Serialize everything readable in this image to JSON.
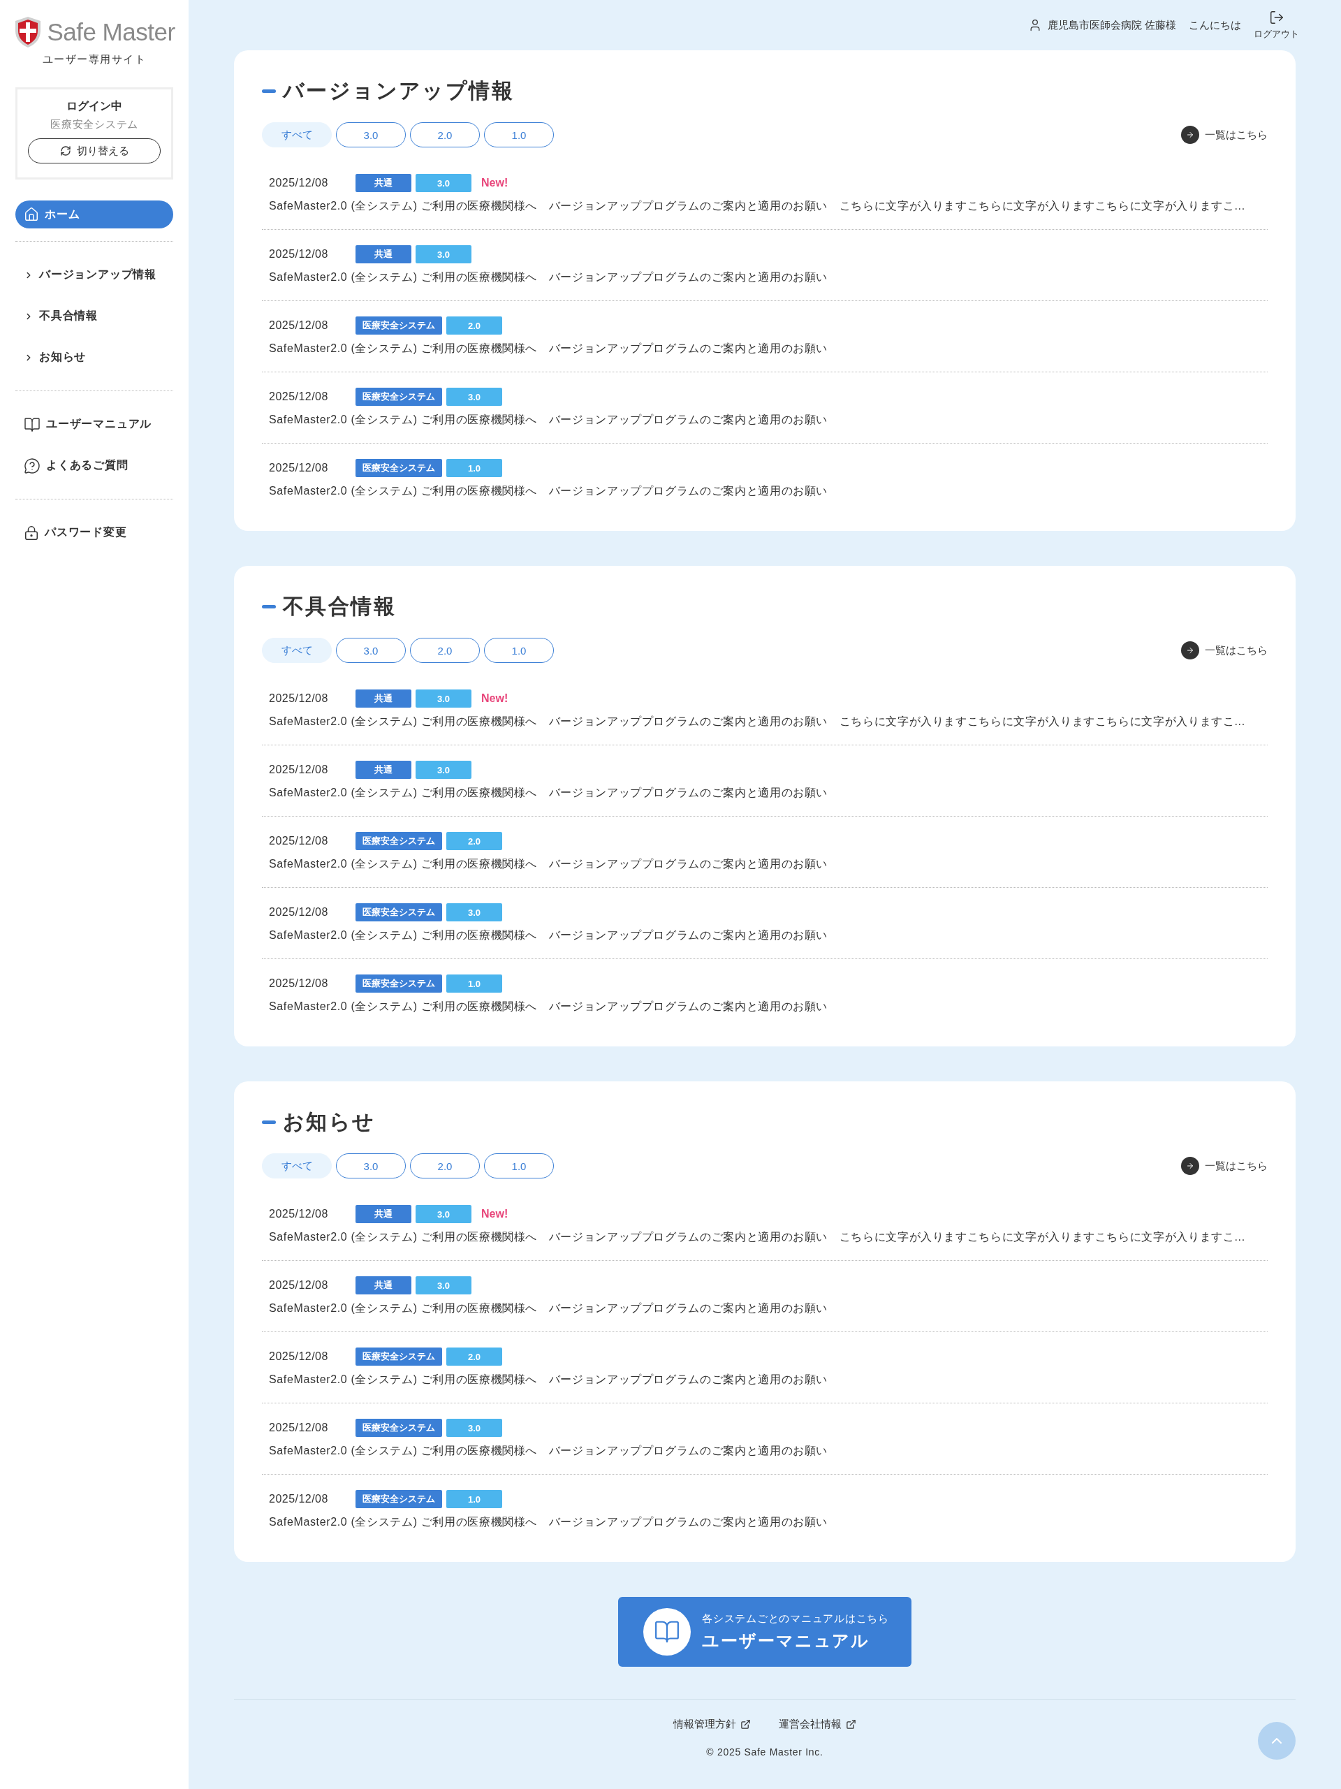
{
  "header": {
    "user": "鹿児島市医師会病院 佐藤様",
    "greeting": "こんにちは",
    "logout": "ログアウト"
  },
  "sidebar": {
    "logo": "Safe Master",
    "subtitle": "ユーザー専用サイト",
    "login": {
      "status": "ログイン中",
      "system": "医療安全システム",
      "switch_button": "切り替える"
    },
    "nav_groups": [
      [
        {
          "label": "ホーム",
          "kind": "home",
          "selected": true
        }
      ],
      [
        {
          "label": "バージョンアップ情報",
          "kind": "link",
          "selected": false
        },
        {
          "label": "不具合情報",
          "kind": "link",
          "selected": false
        },
        {
          "label": "お知らせ",
          "kind": "link",
          "selected": false
        }
      ],
      [
        {
          "label": "ユーザーマニュアル",
          "kind": "manual",
          "selected": false
        },
        {
          "label": "よくあるご質問",
          "kind": "faq",
          "selected": false
        }
      ],
      [
        {
          "label": "パスワード変更",
          "kind": "password",
          "selected": false
        }
      ]
    ]
  },
  "sections": [
    {
      "title": "バージョンアップ情報",
      "filters": [
        {
          "label": "すべて",
          "selected": true
        },
        {
          "label": "3.0",
          "selected": false
        },
        {
          "label": "2.0",
          "selected": false
        },
        {
          "label": "1.0",
          "selected": false
        }
      ],
      "more_link": "一覧はこちら",
      "items": [
        {
          "date": "2025/12/08",
          "tags": [
            {
              "label": "共通",
              "kind": "category"
            },
            {
              "label": "3.0",
              "kind": "version"
            }
          ],
          "badge": "New!",
          "text": "SafeMaster2.0 (全システム) ご利用の医療機関様へ　バージョンアッププログラムのご案内と適用のお願い　こちらに文字が入りますこちらに文字が入りますこちらに文字が入りますこ..."
        },
        {
          "date": "2025/12/08",
          "tags": [
            {
              "label": "共通",
              "kind": "category"
            },
            {
              "label": "3.0",
              "kind": "version"
            }
          ],
          "text": "SafeMaster2.0 (全システム) ご利用の医療機関様へ　バージョンアッププログラムのご案内と適用のお願い"
        },
        {
          "date": "2025/12/08",
          "tags": [
            {
              "label": "医療安全システム",
              "kind": "category"
            },
            {
              "label": "2.0",
              "kind": "version"
            }
          ],
          "text": "SafeMaster2.0 (全システム) ご利用の医療機関様へ　バージョンアッププログラムのご案内と適用のお願い"
        },
        {
          "date": "2025/12/08",
          "tags": [
            {
              "label": "医療安全システム",
              "kind": "category"
            },
            {
              "label": "3.0",
              "kind": "version"
            }
          ],
          "text": "SafeMaster2.0 (全システム) ご利用の医療機関様へ　バージョンアッププログラムのご案内と適用のお願い"
        },
        {
          "date": "2025/12/08",
          "tags": [
            {
              "label": "医療安全システム",
              "kind": "category"
            },
            {
              "label": "1.0",
              "kind": "version"
            }
          ],
          "text": "SafeMaster2.0 (全システム) ご利用の医療機関様へ　バージョンアッププログラムのご案内と適用のお願い"
        }
      ]
    },
    {
      "title": "不具合情報",
      "filters": [
        {
          "label": "すべて",
          "selected": true
        },
        {
          "label": "3.0",
          "selected": false
        },
        {
          "label": "2.0",
          "selected": false
        },
        {
          "label": "1.0",
          "selected": false
        }
      ],
      "more_link": "一覧はこちら",
      "items": [
        {
          "date": "2025/12/08",
          "tags": [
            {
              "label": "共通",
              "kind": "category"
            },
            {
              "label": "3.0",
              "kind": "version"
            }
          ],
          "badge": "New!",
          "text": "SafeMaster2.0 (全システム) ご利用の医療機関様へ　バージョンアッププログラムのご案内と適用のお願い　こちらに文字が入りますこちらに文字が入りますこちらに文字が入りますこ..."
        },
        {
          "date": "2025/12/08",
          "tags": [
            {
              "label": "共通",
              "kind": "category"
            },
            {
              "label": "3.0",
              "kind": "version"
            }
          ],
          "text": "SafeMaster2.0 (全システム) ご利用の医療機関様へ　バージョンアッププログラムのご案内と適用のお願い"
        },
        {
          "date": "2025/12/08",
          "tags": [
            {
              "label": "医療安全システム",
              "kind": "category"
            },
            {
              "label": "2.0",
              "kind": "version"
            }
          ],
          "text": "SafeMaster2.0 (全システム) ご利用の医療機関様へ　バージョンアッププログラムのご案内と適用のお願い"
        },
        {
          "date": "2025/12/08",
          "tags": [
            {
              "label": "医療安全システム",
              "kind": "category"
            },
            {
              "label": "3.0",
              "kind": "version"
            }
          ],
          "text": "SafeMaster2.0 (全システム) ご利用の医療機関様へ　バージョンアッププログラムのご案内と適用のお願い"
        },
        {
          "date": "2025/12/08",
          "tags": [
            {
              "label": "医療安全システム",
              "kind": "category"
            },
            {
              "label": "1.0",
              "kind": "version"
            }
          ],
          "text": "SafeMaster2.0 (全システム) ご利用の医療機関様へ　バージョンアッププログラムのご案内と適用のお願い"
        }
      ]
    },
    {
      "title": "お知らせ",
      "filters": [
        {
          "label": "すべて",
          "selected": true
        },
        {
          "label": "3.0",
          "selected": false
        },
        {
          "label": "2.0",
          "selected": false
        },
        {
          "label": "1.0",
          "selected": false
        }
      ],
      "more_link": "一覧はこちら",
      "items": [
        {
          "date": "2025/12/08",
          "tags": [
            {
              "label": "共通",
              "kind": "category"
            },
            {
              "label": "3.0",
              "kind": "version"
            }
          ],
          "badge": "New!",
          "text": "SafeMaster2.0 (全システム) ご利用の医療機関様へ　バージョンアッププログラムのご案内と適用のお願い　こちらに文字が入りますこちらに文字が入りますこちらに文字が入りますこ..."
        },
        {
          "date": "2025/12/08",
          "tags": [
            {
              "label": "共通",
              "kind": "category"
            },
            {
              "label": "3.0",
              "kind": "version"
            }
          ],
          "text": "SafeMaster2.0 (全システム) ご利用の医療機関様へ　バージョンアッププログラムのご案内と適用のお願い"
        },
        {
          "date": "2025/12/08",
          "tags": [
            {
              "label": "医療安全システム",
              "kind": "category"
            },
            {
              "label": "2.0",
              "kind": "version"
            }
          ],
          "text": "SafeMaster2.0 (全システム) ご利用の医療機関様へ　バージョンアッププログラムのご案内と適用のお願い"
        },
        {
          "date": "2025/12/08",
          "tags": [
            {
              "label": "医療安全システム",
              "kind": "category"
            },
            {
              "label": "3.0",
              "kind": "version"
            }
          ],
          "text": "SafeMaster2.0 (全システム) ご利用の医療機関様へ　バージョンアッププログラムのご案内と適用のお願い"
        },
        {
          "date": "2025/12/08",
          "tags": [
            {
              "label": "医療安全システム",
              "kind": "category"
            },
            {
              "label": "1.0",
              "kind": "version"
            }
          ],
          "text": "SafeMaster2.0 (全システム) ご利用の医療機関様へ　バージョンアッププログラムのご案内と適用のお願い"
        }
      ]
    }
  ],
  "manual_banner": {
    "caption": "各システムごとのマニュアルはこちら",
    "title": "ユーザーマニュアル"
  },
  "footer": {
    "links": [
      "情報管理方針",
      "運営会社情報"
    ],
    "copyright": "© 2025 Safe Master Inc."
  }
}
